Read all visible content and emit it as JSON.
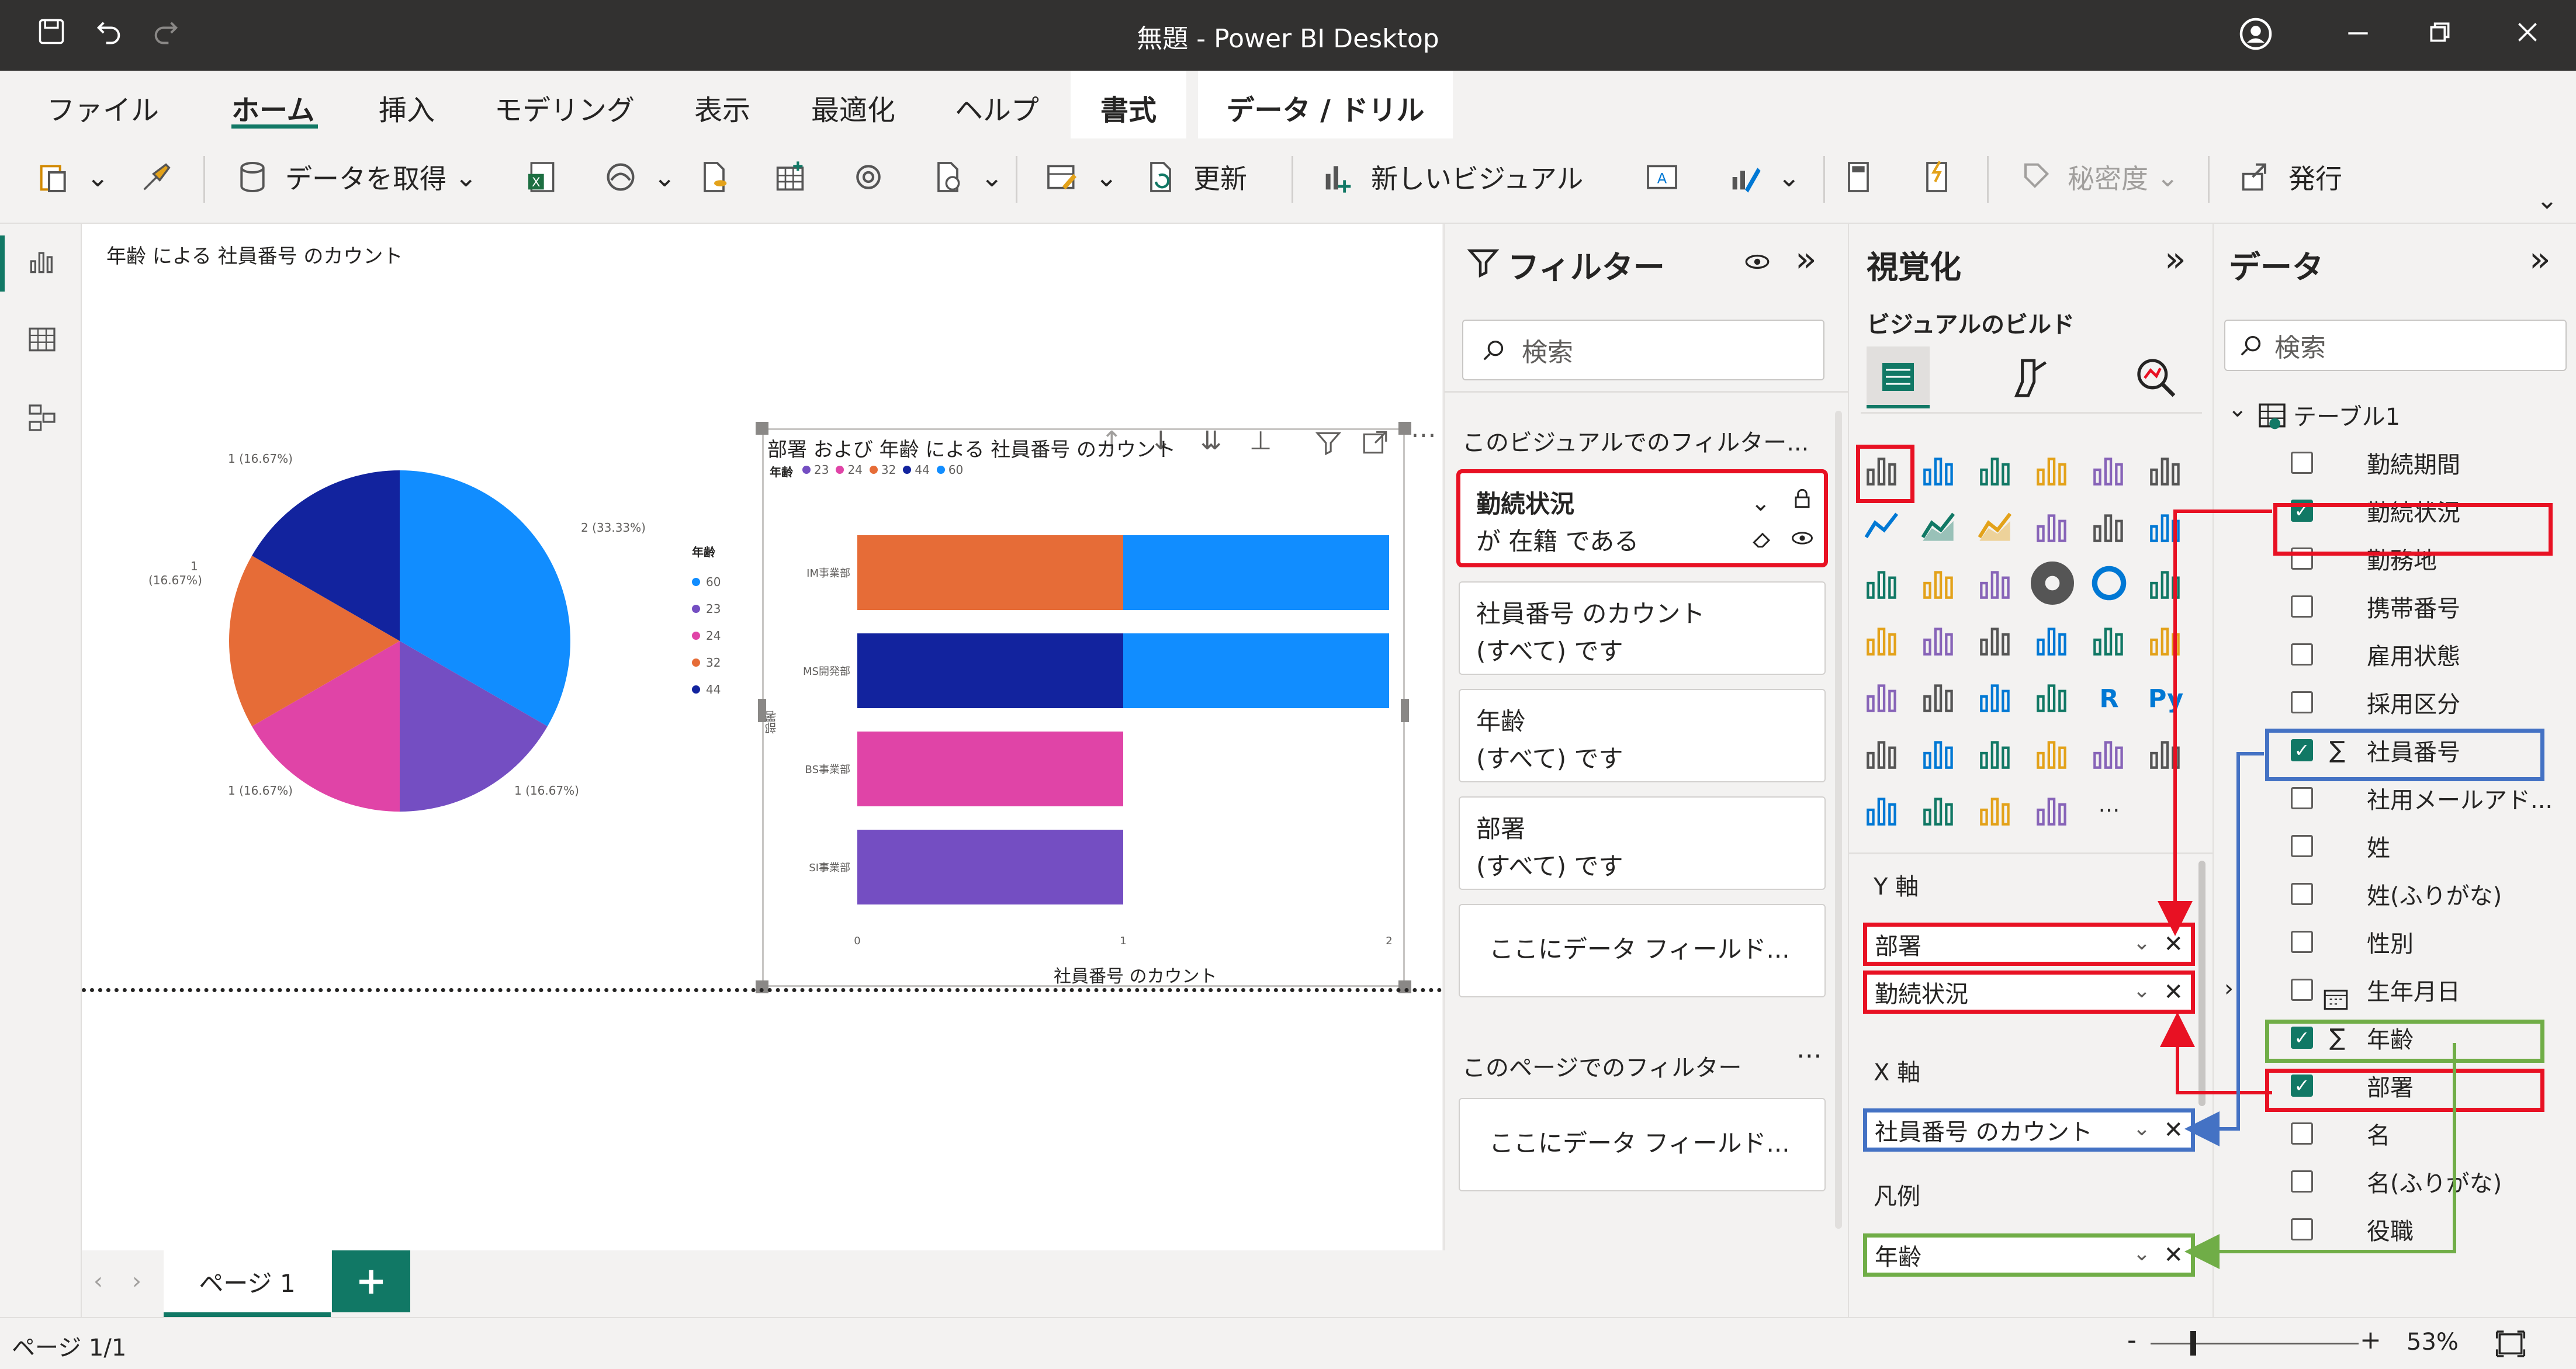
{
  "window": {
    "title": "無題 - Power BI Desktop"
  },
  "tabs": [
    "ファイル",
    "ホーム",
    "挿入",
    "モデリング",
    "表示",
    "最適化",
    "ヘルプ"
  ],
  "context_tabs": [
    "書式",
    "データ / ドリル"
  ],
  "toolbar": {
    "get_data": "データを取得",
    "refresh": "更新",
    "new_visual": "新しいビジュアル",
    "sensitivity": "秘密度",
    "publish": "発行"
  },
  "canvas": {
    "pie": {
      "title": "年齢 による 社員番号 のカウント",
      "labels": [
        "2 (33.33%)",
        "1 (16.67%)",
        "1 (16.67%)",
        "1",
        "(16.67%)",
        "1 (16.67%)"
      ],
      "legend_title": "年齢"
    },
    "bar": {
      "title": "部署 および 年齢 による 社員番号 のカウント",
      "legend_title": "年齢",
      "ylabel": "部署",
      "xlabel": "社員番号 のカウント"
    }
  },
  "chart_data": [
    {
      "type": "pie",
      "title": "年齢 による 社員番号 のカウント",
      "legend": [
        "60",
        "23",
        "24",
        "32",
        "44"
      ],
      "values": [
        2,
        1,
        1,
        1,
        1
      ],
      "colors": [
        "#118dff",
        "#744ec2",
        "#e044a7",
        "#e66c37",
        "#12239e"
      ]
    },
    {
      "type": "bar",
      "title": "部署 および 年齢 による 社員番号 のカウント",
      "categories": [
        "IM事業部",
        "MS開発部",
        "BS事業部",
        "SI事業部"
      ],
      "legend": [
        "23",
        "24",
        "32",
        "44",
        "60"
      ],
      "series": [
        {
          "name": "32",
          "values": [
            1,
            0,
            0,
            0
          ],
          "color": "#e66c37"
        },
        {
          "name": "44",
          "values": [
            0,
            1,
            0,
            0
          ],
          "color": "#12239e"
        },
        {
          "name": "24",
          "values": [
            0,
            0,
            1,
            0
          ],
          "color": "#e044a7"
        },
        {
          "name": "23",
          "values": [
            0,
            0,
            0,
            1
          ],
          "color": "#744ec2"
        },
        {
          "name": "60",
          "values": [
            1,
            1,
            0,
            0
          ],
          "color": "#118dff"
        }
      ],
      "xlabel": "社員番号 のカウント",
      "ylabel": "部署",
      "xlim": [
        0,
        2
      ],
      "xticks": [
        "0",
        "1",
        "2"
      ]
    }
  ],
  "filters": {
    "title": "フィルター",
    "search_placeholder": "検索",
    "visual_section": "このビジュアルでのフィルター...",
    "cards": [
      {
        "field": "勤続状況",
        "cond": "が 在籍 である"
      },
      {
        "field": "社員番号 のカウント",
        "cond": "(すべて) です"
      },
      {
        "field": "年齢",
        "cond": "(すべて) です"
      },
      {
        "field": "部署",
        "cond": "(すべて) です"
      }
    ],
    "drop_here": "ここにデータ フィールド...",
    "page_section": "このページでのフィルター",
    "drop_here_page": "ここにデータ フィールド..."
  },
  "viz": {
    "title": "視覚化",
    "build": "ビジュアルのビルド",
    "y_axis": "Y 軸",
    "y_fields": [
      "部署",
      "勤続状況"
    ],
    "x_axis": "X 軸",
    "x_fields": [
      "社員番号 のカウント"
    ],
    "legend": "凡例",
    "legend_fields": [
      "年齢"
    ]
  },
  "data": {
    "title": "データ",
    "search_placeholder": "検索",
    "table": "テーブル1",
    "fields": [
      {
        "name": "勤続期間",
        "checked": false
      },
      {
        "name": "勤続状況",
        "checked": true
      },
      {
        "name": "勤務地",
        "checked": false
      },
      {
        "name": "携帯番号",
        "checked": false
      },
      {
        "name": "雇用状態",
        "checked": false
      },
      {
        "name": "採用区分",
        "checked": false
      },
      {
        "name": "社員番号",
        "checked": true
      },
      {
        "name": "社用メールアド...",
        "checked": false
      },
      {
        "name": "姓",
        "checked": false
      },
      {
        "name": "姓(ふりがな)",
        "checked": false
      },
      {
        "name": "性別",
        "checked": false
      },
      {
        "name": "生年月日",
        "checked": false
      },
      {
        "name": "年齢",
        "checked": true
      },
      {
        "name": "部署",
        "checked": true
      },
      {
        "name": "名",
        "checked": false
      },
      {
        "name": "名(ふりがな)",
        "checked": false
      },
      {
        "name": "役職",
        "checked": false
      }
    ]
  },
  "pages": {
    "tab": "ページ 1",
    "add": "+"
  },
  "status": {
    "page": "ページ 1/1",
    "zoom": "53%",
    "minus": "-",
    "plus": "+"
  }
}
